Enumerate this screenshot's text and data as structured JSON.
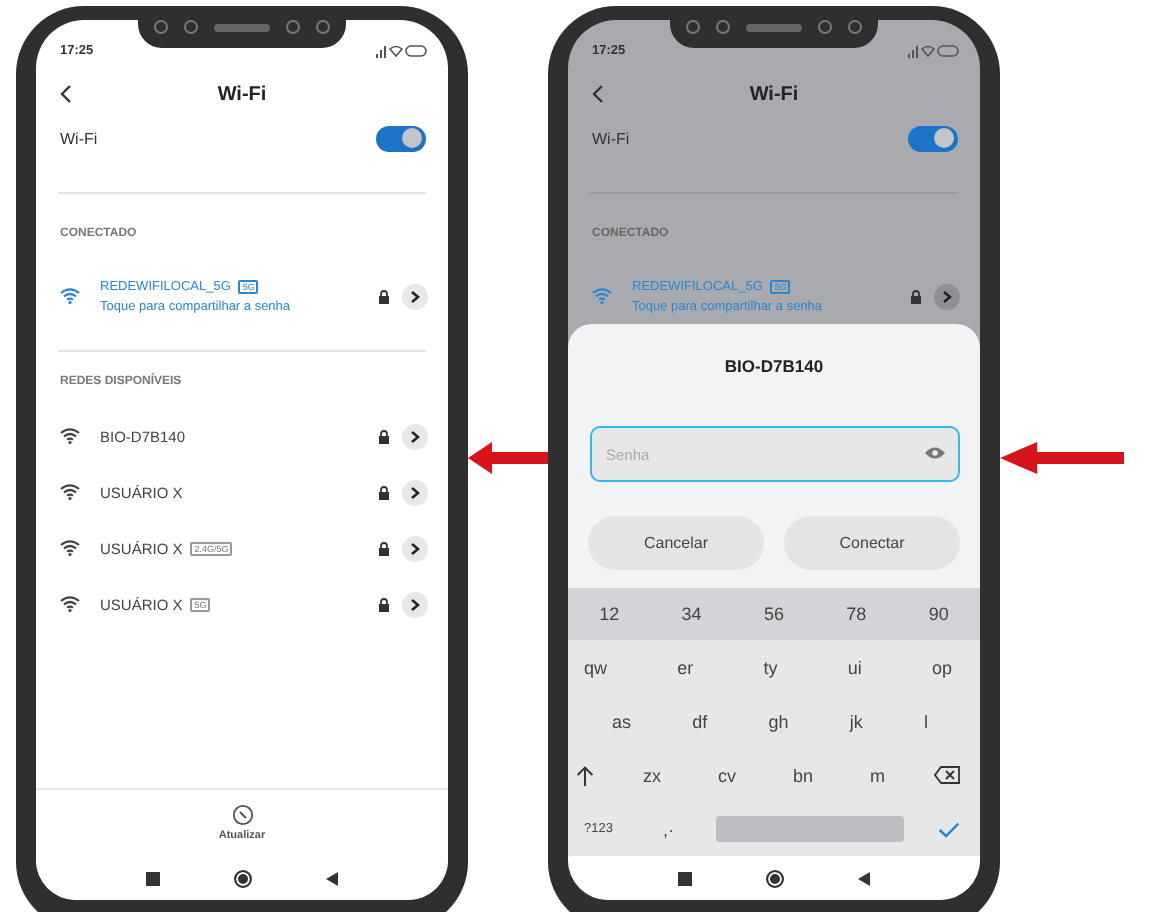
{
  "phones": [
    {
      "status_time": "17:25",
      "title": "Wi-Fi",
      "wifi_label": "Wi-Fi",
      "wifi_on": true,
      "dimmed": false,
      "sections": [
        {
          "heading": "CONECTADO",
          "networks": [
            {
              "name": "REDEWIFILOCAL_5G",
              "band": "5G",
              "subtitle": "Toque para compartilhar a senha",
              "connected": true
            }
          ]
        },
        {
          "heading": "REDES DISPONÍVEIS",
          "networks": [
            {
              "name": "BIO-D7B140",
              "connected": false
            },
            {
              "name": "USUÁRIO X",
              "connected": false
            },
            {
              "name": "USUÁRIO X",
              "band": "2.4G/5G",
              "connected": false
            },
            {
              "name": "USUÁRIO X",
              "band": "5G",
              "connected": false
            }
          ]
        }
      ],
      "bottom_action": "Atualizar"
    },
    {
      "status_time": "17:25",
      "title": "Wi-Fi",
      "wifi_label": "Wi-Fi",
      "wifi_on": true,
      "dimmed": true,
      "sections": [
        {
          "heading": "CONECTADO",
          "networks": [
            {
              "name": "REDEWIFILOCAL_5G",
              "band": "5G",
              "subtitle": "Toque para compartilhar a senha",
              "connected": true
            }
          ]
        }
      ],
      "dialog": {
        "title": "BIO-D7B140",
        "password": {
          "placeholder": "Senha"
        },
        "buttons": [
          "Cancelar",
          "Conectar"
        ],
        "keyboard": {
          "number_row": [
            "12",
            "34",
            "56",
            "78",
            "90"
          ],
          "rows": [
            [
              {
                "kind": "char",
                "label": "qw"
              },
              {
                "kind": "char",
                "label": "er"
              },
              {
                "kind": "char",
                "label": "ty"
              },
              {
                "kind": "char",
                "label": "ui"
              },
              {
                "kind": "char",
                "label": "op"
              }
            ],
            [
              {
                "kind": "char",
                "label": "as"
              },
              {
                "kind": "char",
                "label": "df"
              },
              {
                "kind": "char",
                "label": "gh"
              },
              {
                "kind": "char",
                "label": "jk"
              },
              {
                "kind": "char",
                "label": "l"
              }
            ],
            [
              {
                "kind": "shift"
              },
              {
                "kind": "char",
                "label": "zx"
              },
              {
                "kind": "char",
                "label": "cv"
              },
              {
                "kind": "char",
                "label": "bn"
              },
              {
                "kind": "char",
                "label": "m"
              },
              {
                "kind": "backspace"
              }
            ],
            [
              {
                "kind": "symbols",
                "label": "?123"
              },
              {
                "kind": "char",
                "label": ",·"
              },
              {
                "kind": "space"
              },
              {
                "kind": "enter"
              }
            ]
          ]
        }
      }
    }
  ]
}
